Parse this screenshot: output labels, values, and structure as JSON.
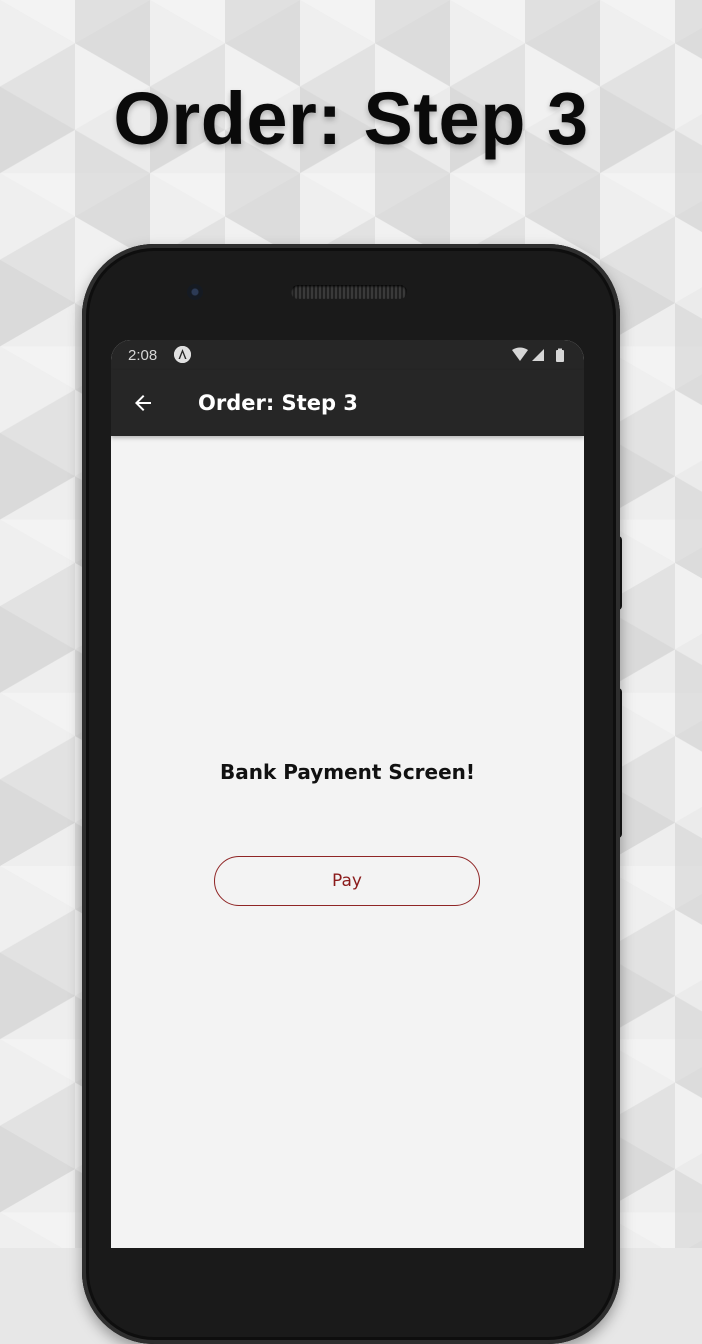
{
  "headline": "Order: Step 3",
  "status_bar": {
    "time": "2:08",
    "app_icon": "angular-logo-icon",
    "icons": [
      "wifi-icon",
      "cell-signal-icon",
      "battery-icon"
    ]
  },
  "app_bar": {
    "back_icon": "arrow-left-icon",
    "title": "Order: Step 3"
  },
  "content": {
    "title": "Bank Payment Screen!",
    "pay_label": "Pay"
  },
  "colors": {
    "app_bar": "#262626",
    "screen_background": "#f3f3f3",
    "accent": "#8a1a1a"
  }
}
